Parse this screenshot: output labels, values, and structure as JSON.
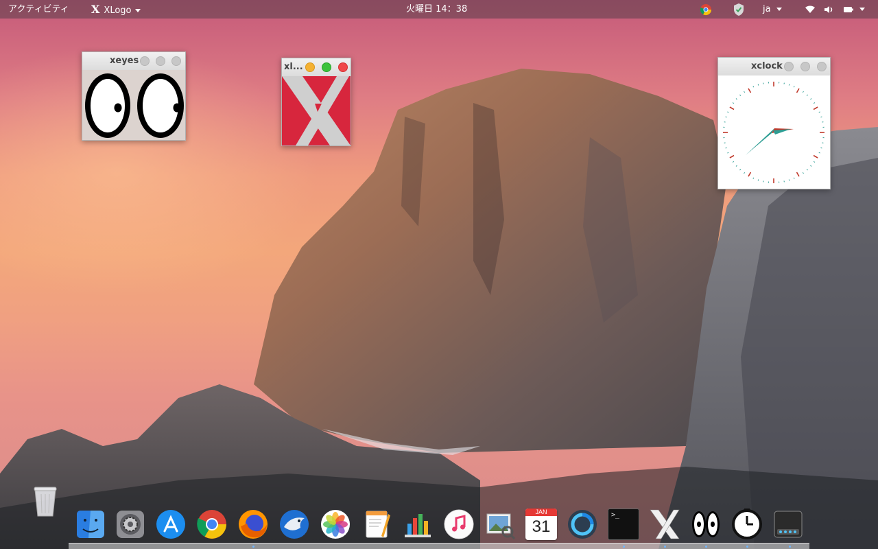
{
  "topbar": {
    "activities_label": "アクティビティ",
    "app_menu_label": "XLogo",
    "app_menu_glyph": "X",
    "clock": "火曜日 14：38",
    "input_method": "ja"
  },
  "windows": {
    "xeyes": {
      "title": "xeyes"
    },
    "xlogo": {
      "title": "xl..."
    },
    "xclock": {
      "title": "xclock",
      "time": "14:38"
    }
  },
  "dock": {
    "items": [
      {
        "name": "Finder",
        "icon": "finder-icon"
      },
      {
        "name": "System Preferences",
        "icon": "settings-icon"
      },
      {
        "name": "App Store",
        "icon": "app-store-icon"
      },
      {
        "name": "Google Chrome",
        "icon": "chrome-icon"
      },
      {
        "name": "Firefox",
        "icon": "firefox-icon"
      },
      {
        "name": "Thunderbird",
        "icon": "thunderbird-icon"
      },
      {
        "name": "Photos",
        "icon": "photos-icon"
      },
      {
        "name": "Pages",
        "icon": "pages-icon"
      },
      {
        "name": "Numbers",
        "icon": "numbers-icon"
      },
      {
        "name": "iTunes",
        "icon": "music-icon"
      },
      {
        "name": "Preview",
        "icon": "preview-icon"
      },
      {
        "name": "Calendar",
        "icon": "calendar-icon",
        "month": "JAN",
        "day": "31"
      },
      {
        "name": "Web Browser",
        "icon": "globe-icon"
      },
      {
        "name": "Terminal",
        "icon": "terminal-icon",
        "prompt": ">_"
      },
      {
        "name": "XLogo",
        "icon": "xlogo-icon"
      },
      {
        "name": "xeyes",
        "icon": "xeyes-icon"
      },
      {
        "name": "xclock",
        "icon": "xclock-icon"
      },
      {
        "name": "Disks",
        "icon": "disks-icon"
      }
    ]
  },
  "colors": {
    "xlogo_red": "#d7263d",
    "clock_hand": "#2e9e94",
    "clock_second": "#c0392b"
  }
}
